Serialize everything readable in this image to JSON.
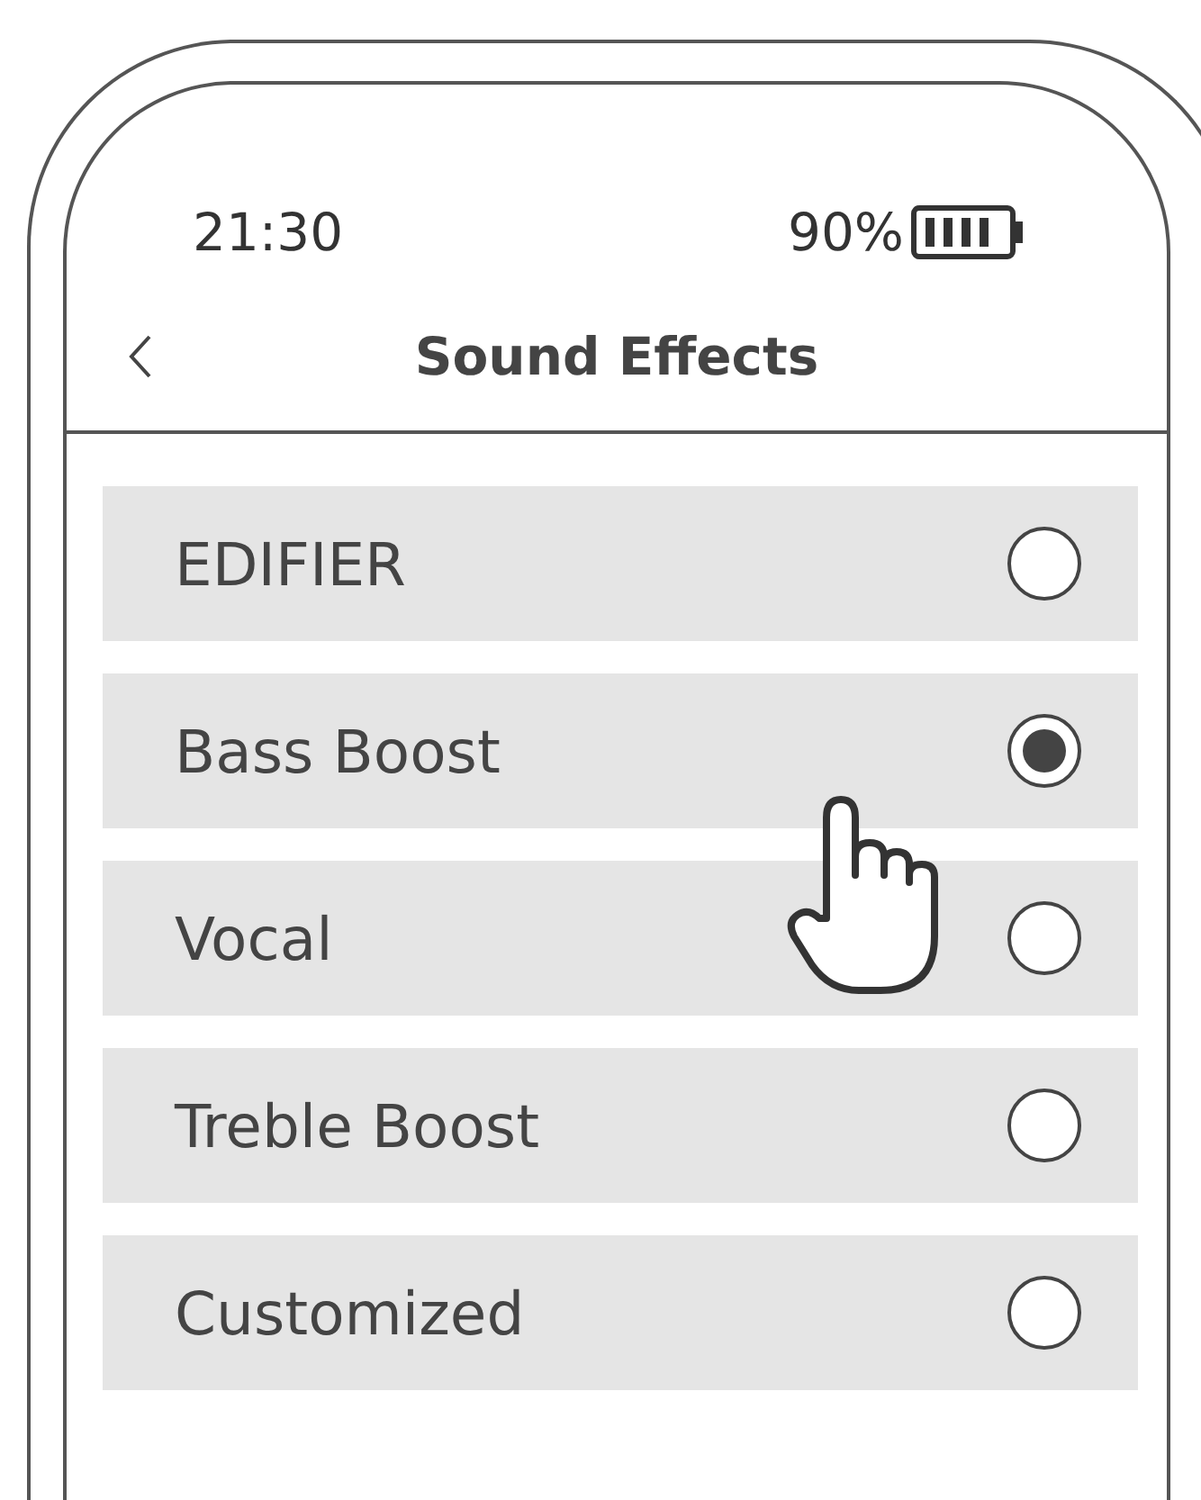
{
  "status_bar": {
    "time": "21:30",
    "battery": "90%"
  },
  "header": {
    "title": "Sound Effects"
  },
  "options": [
    {
      "label": "EDIFIER",
      "selected": false
    },
    {
      "label": "Bass Boost",
      "selected": true
    },
    {
      "label": "Vocal",
      "selected": false
    },
    {
      "label": "Treble Boost",
      "selected": false
    },
    {
      "label": "Customized",
      "selected": false
    }
  ]
}
